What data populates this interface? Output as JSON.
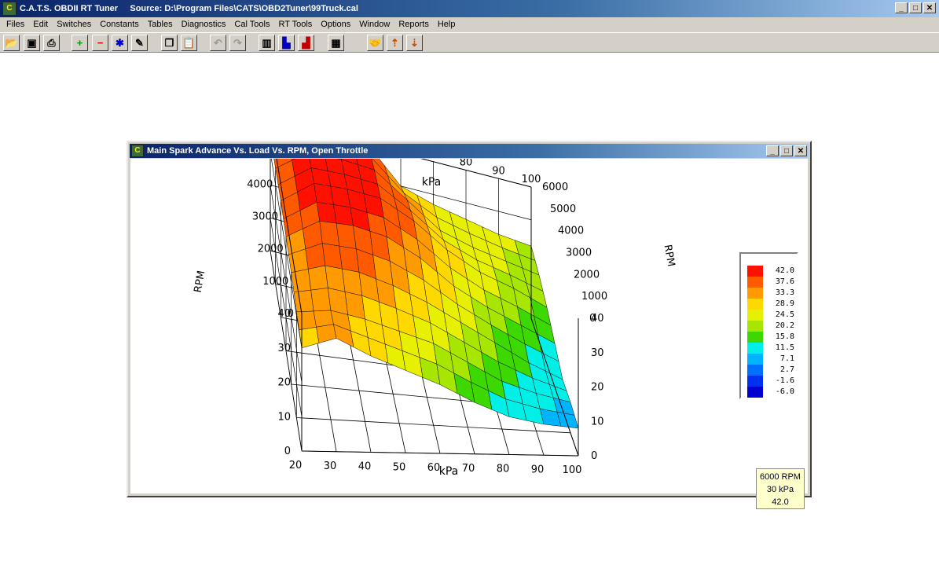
{
  "app": {
    "title": "C.A.T.S. OBDII RT Tuner     Source: D:\\Program Files\\CATS\\OBD2Tuner\\99Truck.cal",
    "window_buttons": {
      "minimize": "_",
      "maximize": "□",
      "close": "✕"
    }
  },
  "menu": [
    "Files",
    "Edit",
    "Switches",
    "Constants",
    "Tables",
    "Diagnostics",
    "Cal Tools",
    "RT Tools",
    "Options",
    "Window",
    "Reports",
    "Help"
  ],
  "toolbar": [
    {
      "icon": "open-folder-icon",
      "glyph": "📂"
    },
    {
      "icon": "save-icon",
      "glyph": "▣"
    },
    {
      "icon": "print-icon",
      "glyph": "⎙"
    },
    {
      "icon": "add-icon",
      "glyph": "+",
      "color": "#00a000"
    },
    {
      "icon": "subtract-icon",
      "glyph": "−",
      "color": "#d00000"
    },
    {
      "icon": "multiply-icon",
      "glyph": "✱",
      "color": "#0000d0"
    },
    {
      "icon": "edit-pencil-icon",
      "glyph": "✎"
    },
    {
      "icon": "copy-icon",
      "glyph": "❐"
    },
    {
      "icon": "paste-icon",
      "glyph": "📋"
    },
    {
      "icon": "undo-icon",
      "glyph": "↶",
      "disabled": true
    },
    {
      "icon": "redo-icon",
      "glyph": "↷",
      "disabled": true
    },
    {
      "icon": "table-view-icon",
      "glyph": "▥"
    },
    {
      "icon": "bar-graph-icon",
      "glyph": "▙",
      "color": "#0000c0"
    },
    {
      "icon": "graph-edit-icon",
      "glyph": "▟",
      "color": "#c00000"
    },
    {
      "icon": "grid-icon",
      "glyph": "▦"
    },
    {
      "icon": "connect-handshake-icon",
      "glyph": "🤝"
    },
    {
      "icon": "upload-icon",
      "glyph": "⇡",
      "color": "#c05000"
    },
    {
      "icon": "download-icon",
      "glyph": "⇣",
      "color": "#c05000"
    }
  ],
  "child_window": {
    "title": "Main Spark Advance Vs. Load Vs. RPM, Open Throttle"
  },
  "chart_data": {
    "type": "surface3d",
    "title": "",
    "axes": {
      "x": {
        "label": "kPa",
        "ticks": [
          20,
          30,
          40,
          50,
          60,
          70,
          80,
          90,
          100
        ],
        "range": [
          20,
          100
        ]
      },
      "y": {
        "label": "RPM",
        "ticks": [
          0,
          1000,
          2000,
          3000,
          4000,
          5000,
          6000
        ],
        "range": [
          0,
          6000
        ]
      },
      "z": {
        "label": "",
        "ticks": [
          0,
          10,
          20,
          30,
          40
        ],
        "range": [
          0,
          40
        ]
      }
    },
    "kpa": [
      20,
      30,
      40,
      50,
      60,
      70,
      80,
      90,
      100
    ],
    "rpm": [
      0,
      1000,
      2000,
      3000,
      4000,
      5000,
      6000
    ],
    "advance": [
      [
        30,
        33,
        28,
        24,
        20,
        15,
        11,
        9,
        8
      ],
      [
        31,
        32,
        30,
        27,
        24,
        19,
        14,
        11,
        9
      ],
      [
        33,
        36,
        35,
        32,
        28,
        23,
        18,
        13,
        9
      ],
      [
        34,
        40,
        40,
        38,
        33,
        26,
        21,
        17,
        13
      ],
      [
        35,
        42,
        42,
        41,
        36,
        29,
        24,
        21,
        17
      ],
      [
        35,
        42,
        42,
        41,
        34,
        27,
        24,
        22,
        20
      ],
      [
        35,
        42,
        42,
        40,
        30,
        27,
        25,
        23,
        22
      ]
    ],
    "legend": {
      "entries": [
        "42.0",
        "37.6",
        "33.3",
        "28.9",
        "24.5",
        "20.2",
        "15.8",
        "11.5",
        "7.1",
        "2.7",
        "-1.6",
        "-6.0"
      ],
      "colors": [
        "#ff1000",
        "#ff5a00",
        "#ff9a00",
        "#ffd800",
        "#e6f000",
        "#a6e600",
        "#3cd800",
        "#00f0e8",
        "#00b4ff",
        "#0070ff",
        "#0030f0",
        "#0000d0"
      ]
    },
    "readout": {
      "rpm": "6000 RPM",
      "kpa": "30 kPa",
      "value": "42.0"
    }
  }
}
